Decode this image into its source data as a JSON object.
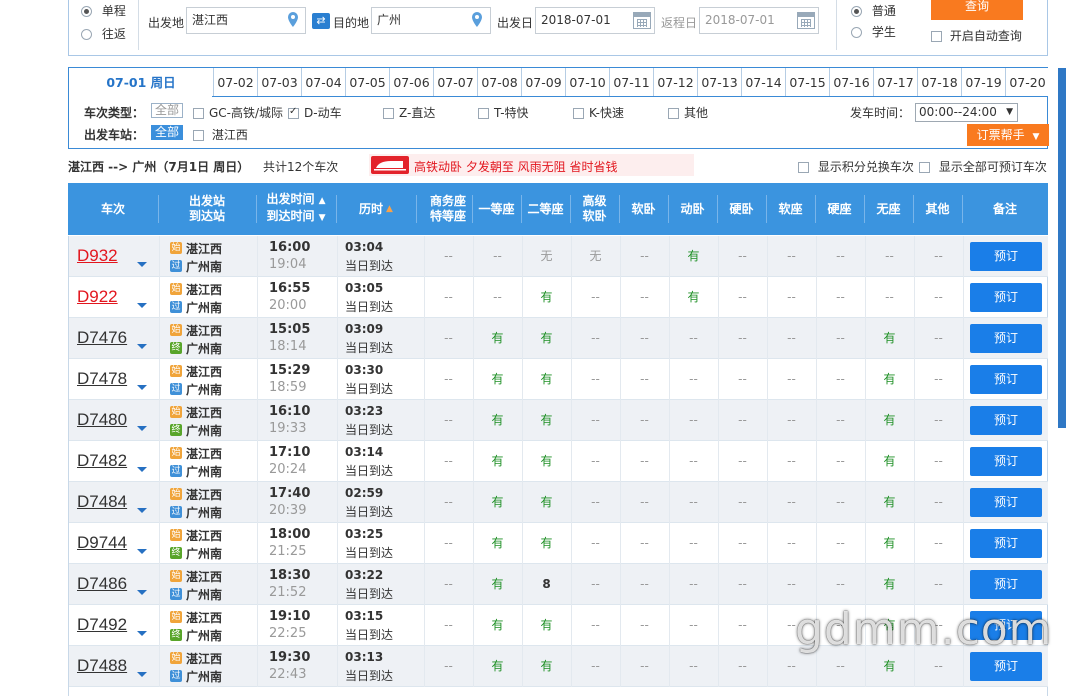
{
  "search": {
    "trip_types": [
      "单程",
      "往返"
    ],
    "from_label": "出发地",
    "from_value": "湛江西",
    "to_label": "目的地",
    "to_value": "广州",
    "depart_label": "出发日",
    "depart_value": "2018-07-01",
    "return_label": "返程日",
    "return_value": "2018-07-01",
    "passenger_types": [
      "普通",
      "学生"
    ],
    "query_button": "查询",
    "auto_query_label": "开启自动查询"
  },
  "date_tabs": [
    "07-01 周日",
    "07-02",
    "07-03",
    "07-04",
    "07-05",
    "07-06",
    "07-07",
    "07-08",
    "07-09",
    "07-10",
    "07-11",
    "07-12",
    "07-13",
    "07-14",
    "07-15",
    "07-16",
    "07-17",
    "07-18",
    "07-19",
    "07-20"
  ],
  "filters": {
    "type_label": "车次类型：",
    "all": "全部",
    "types": [
      {
        "label": "GC-高铁/城际",
        "checked": false
      },
      {
        "label": "D-动车",
        "checked": true
      },
      {
        "label": "Z-直达",
        "checked": false
      },
      {
        "label": "T-特快",
        "checked": false
      },
      {
        "label": "K-快速",
        "checked": false
      },
      {
        "label": "其他",
        "checked": false
      }
    ],
    "station_label": "出发车站：",
    "stations": [
      {
        "label": "湛江西",
        "checked": false
      }
    ],
    "time_label": "发车时间：",
    "time_value": "00:00--24:00",
    "helper_button": "订票帮手"
  },
  "summary": {
    "route": "湛江西 --> 广州（7月1日  周日）",
    "count_text": "共计12个车次",
    "ad_text": "高铁动卧 夕发朝至 风雨无阻 省时省钱",
    "points_label": "显示积分兑换车次",
    "bookable_label": "显示全部可预订车次"
  },
  "table": {
    "headers": {
      "train": "车次",
      "stations": [
        "出发站",
        "到达站"
      ],
      "times": [
        "出发时间",
        "到达时间"
      ],
      "duration": "历时",
      "business": [
        "商务座",
        "特等座"
      ],
      "first": "一等座",
      "second": "二等座",
      "premium_soft": [
        "高级",
        "软卧"
      ],
      "soft_sleeper": "软卧",
      "d_sleeper": "动卧",
      "hard_sleeper": "硬卧",
      "soft_seat": "软座",
      "hard_seat": "硬座",
      "no_seat": "无座",
      "other": "其他",
      "note": "备注"
    },
    "book_label": "预订",
    "same_day": "当日到达",
    "rows": [
      {
        "no": "D932",
        "red": true,
        "from": "湛江西",
        "to": "广州南",
        "from_tag": "始",
        "to_tag": "过",
        "dep": "16:00",
        "arr": "19:04",
        "dur": "03:04",
        "seats": [
          "--",
          "--",
          "无",
          "无",
          "--",
          "有",
          "--",
          "--",
          "--",
          "--",
          "--"
        ]
      },
      {
        "no": "D922",
        "red": true,
        "from": "湛江西",
        "to": "广州南",
        "from_tag": "始",
        "to_tag": "过",
        "dep": "16:55",
        "arr": "20:00",
        "dur": "03:05",
        "seats": [
          "--",
          "--",
          "有",
          "--",
          "--",
          "有",
          "--",
          "--",
          "--",
          "--",
          "--"
        ]
      },
      {
        "no": "D7476",
        "red": false,
        "from": "湛江西",
        "to": "广州南",
        "from_tag": "始",
        "to_tag": "终",
        "dep": "15:05",
        "arr": "18:14",
        "dur": "03:09",
        "seats": [
          "--",
          "有",
          "有",
          "--",
          "--",
          "--",
          "--",
          "--",
          "--",
          "有",
          "--"
        ]
      },
      {
        "no": "D7478",
        "red": false,
        "from": "湛江西",
        "to": "广州南",
        "from_tag": "始",
        "to_tag": "过",
        "dep": "15:29",
        "arr": "18:59",
        "dur": "03:30",
        "seats": [
          "--",
          "有",
          "有",
          "--",
          "--",
          "--",
          "--",
          "--",
          "--",
          "有",
          "--"
        ]
      },
      {
        "no": "D7480",
        "red": false,
        "from": "湛江西",
        "to": "广州南",
        "from_tag": "始",
        "to_tag": "终",
        "dep": "16:10",
        "arr": "19:33",
        "dur": "03:23",
        "seats": [
          "--",
          "有",
          "有",
          "--",
          "--",
          "--",
          "--",
          "--",
          "--",
          "有",
          "--"
        ]
      },
      {
        "no": "D7482",
        "red": false,
        "from": "湛江西",
        "to": "广州南",
        "from_tag": "始",
        "to_tag": "过",
        "dep": "17:10",
        "arr": "20:24",
        "dur": "03:14",
        "seats": [
          "--",
          "有",
          "有",
          "--",
          "--",
          "--",
          "--",
          "--",
          "--",
          "有",
          "--"
        ]
      },
      {
        "no": "D7484",
        "red": false,
        "from": "湛江西",
        "to": "广州南",
        "from_tag": "始",
        "to_tag": "过",
        "dep": "17:40",
        "arr": "20:39",
        "dur": "02:59",
        "seats": [
          "--",
          "有",
          "有",
          "--",
          "--",
          "--",
          "--",
          "--",
          "--",
          "有",
          "--"
        ]
      },
      {
        "no": "D9744",
        "red": false,
        "from": "湛江西",
        "to": "广州南",
        "from_tag": "始",
        "to_tag": "终",
        "dep": "18:00",
        "arr": "21:25",
        "dur": "03:25",
        "seats": [
          "--",
          "有",
          "有",
          "--",
          "--",
          "--",
          "--",
          "--",
          "--",
          "有",
          "--"
        ]
      },
      {
        "no": "D7486",
        "red": false,
        "from": "湛江西",
        "to": "广州南",
        "from_tag": "始",
        "to_tag": "过",
        "dep": "18:30",
        "arr": "21:52",
        "dur": "03:22",
        "seats": [
          "--",
          "有",
          "8",
          "--",
          "--",
          "--",
          "--",
          "--",
          "--",
          "有",
          "--"
        ]
      },
      {
        "no": "D7492",
        "red": false,
        "from": "湛江西",
        "to": "广州南",
        "from_tag": "始",
        "to_tag": "终",
        "dep": "19:10",
        "arr": "22:25",
        "dur": "03:15",
        "seats": [
          "--",
          "有",
          "有",
          "--",
          "--",
          "--",
          "--",
          "--",
          "--",
          "有",
          "--"
        ]
      },
      {
        "no": "D7488",
        "red": false,
        "from": "湛江西",
        "to": "广州南",
        "from_tag": "始",
        "to_tag": "过",
        "dep": "19:30",
        "arr": "22:43",
        "dur": "03:13",
        "seats": [
          "--",
          "有",
          "有",
          "--",
          "--",
          "--",
          "--",
          "--",
          "--",
          "有",
          "--"
        ]
      }
    ]
  },
  "watermark": "gdmm.com",
  "colors": {
    "accent": "#3b94df",
    "orange": "#f97a1f",
    "yes": "#1d8f24",
    "red_train": "#e2161e"
  }
}
